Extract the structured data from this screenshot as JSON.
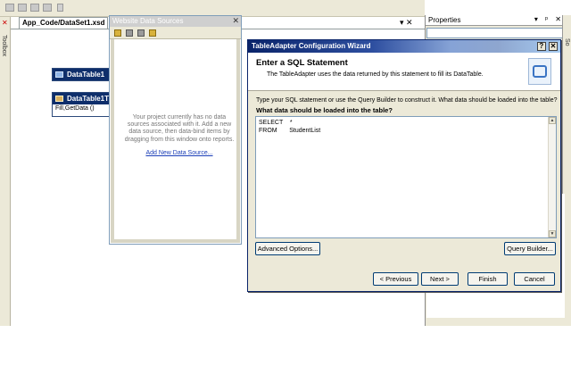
{
  "designer": {
    "tab_title": "App_Code/DataSet1.xsd",
    "doc_close": "▾ ✕"
  },
  "toolbox": {
    "label": "Toolbox"
  },
  "datatables": [
    {
      "title": "DataTable1"
    },
    {
      "title": "DataTable1T",
      "method": "Fill,GetData ()"
    }
  ],
  "website_data_sources": {
    "title": "Website Data Sources",
    "message": "Your project currently has no data sources associated with it.  Add a new data source, then data-bind items by dragging from this window onto reports.",
    "link": "Add New Data Source..."
  },
  "properties": {
    "title": "Properties",
    "controls": "▾ ᵖ ✕"
  },
  "solution_strip": {
    "label": "So"
  },
  "wizard": {
    "title": "TableAdapter Configuration Wizard",
    "help": "?",
    "close": "✕",
    "heading": "Enter a SQL Statement",
    "subheading": "The TableAdapter uses the data returned by this statement to fill its DataTable.",
    "prompt": "Type your SQL statement or use the Query Builder to construct it.  What data should be loaded into the table?",
    "question": "What data should be loaded into the table?",
    "sql": "SELECT    *\nFROM       StudentList",
    "buttons": {
      "advanced": "Advanced Options...",
      "query_builder": "Query Builder...",
      "previous": "< Previous",
      "next": "Next >",
      "finish": "Finish",
      "cancel": "Cancel"
    }
  },
  "colors": {
    "title_bar": "#0a246a",
    "dialog_bg": "#ece9d8",
    "link": "#1c3fb8",
    "datatable_header": "#0e2e6b"
  }
}
